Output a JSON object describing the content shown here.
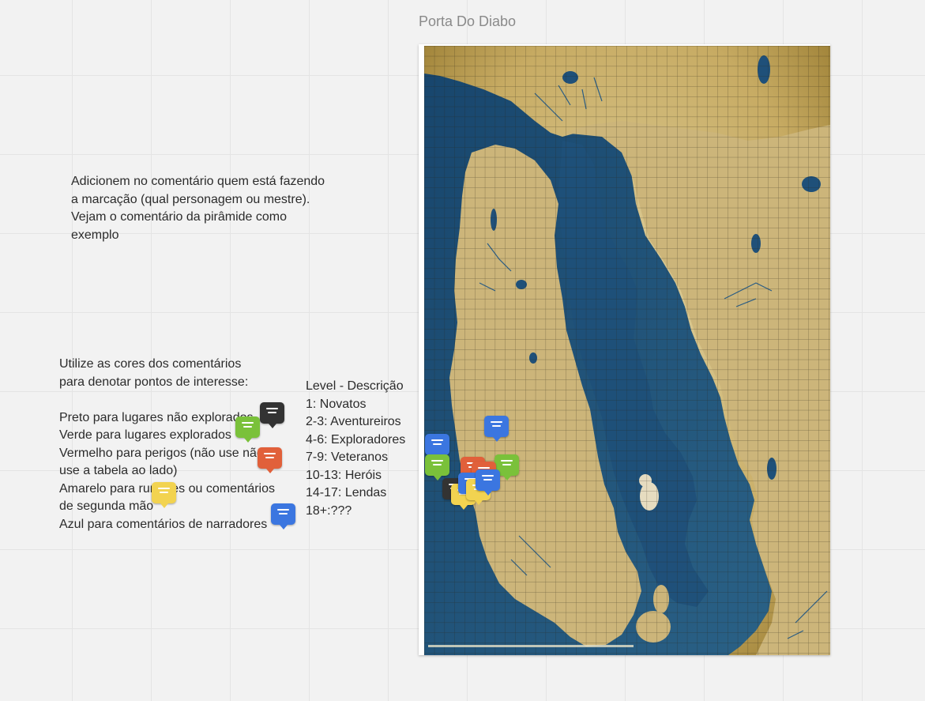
{
  "frame": {
    "title": "Porta Do Diabo"
  },
  "notes": {
    "instructions": "Adicionem no comentário quem está fazendo\na marcação (qual personagem ou mestre).\nVejam o comentário da pirâmide como\nexemplo",
    "legend": "Utilize as cores dos comentários\npara denotar pontos de interesse:\n\nPreto para lugares não explorados\nVerde para lugares explorados\nVermelho para perigos (não use não\nuse a tabela ao lado)\nAmarelo para rumores ou comentários\nde segunda mão\nAzul para comentários de narradores",
    "levels": "Level - Descrição\n1: Novatos\n2-3: Aventureiros\n4-6: Exploradores\n7-9: Veteranos\n10-13: Heróis\n14-17: Lendas\n18+:???"
  },
  "colors": {
    "black": "#333333",
    "green": "#7ac13a",
    "red": "#e1603a",
    "yellow": "#f2d350",
    "blue": "#3b76e0",
    "sea": "#1d4f76",
    "land": "#c9b06e"
  },
  "comment_pins": [
    {
      "color": "black",
      "icon": "comment-icon"
    },
    {
      "color": "green",
      "icon": "comment-icon"
    },
    {
      "color": "red",
      "icon": "comment-icon"
    },
    {
      "color": "yellow",
      "icon": "comment-icon"
    },
    {
      "color": "blue",
      "icon": "comment-icon"
    },
    {
      "color": "blue",
      "icon": "comment-icon"
    },
    {
      "color": "blue",
      "icon": "comment-icon"
    },
    {
      "color": "green",
      "icon": "comment-icon"
    },
    {
      "color": "green",
      "icon": "comment-icon"
    },
    {
      "color": "black",
      "icon": "comment-icon"
    },
    {
      "color": "yellow",
      "icon": "comment-icon"
    },
    {
      "color": "red",
      "icon": "comment-icon"
    },
    {
      "color": "red",
      "icon": "comment-icon"
    },
    {
      "color": "blue",
      "icon": "comment-icon"
    },
    {
      "color": "yellow",
      "icon": "comment-icon"
    },
    {
      "color": "blue",
      "icon": "comment-icon"
    }
  ]
}
